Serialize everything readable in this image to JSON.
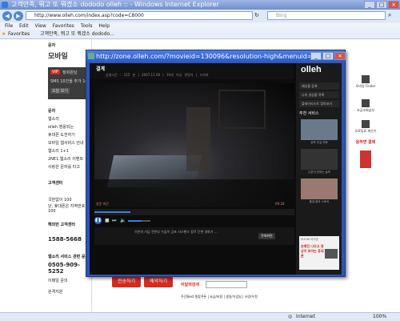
{
  "browser": {
    "title": "고객만족, 뭐고 또 뭐겠소 dododo olleh :: - Windows Internet Explorer",
    "url": "http://www.olleh.com/index.asp?code=C8000",
    "search_placeholder": "Bing",
    "menu": [
      "File",
      "Edit",
      "View",
      "Favorites",
      "Tools",
      "Help"
    ],
    "favorites_label": "Favorites",
    "tab_title": "고객만족, 뭐고 또 뭐겠소 dododo...",
    "status_text": "Internet",
    "zoom": "100%"
  },
  "page": {
    "header_small": "문자",
    "left_title": "모바일",
    "vip_label": "VIP",
    "vip_lines": [
      "정회원님",
      "SMS 10건을 추가 100%",
      "오늘 보기"
    ],
    "left_menu": [
      "문자",
      "웹소리",
      "olleh 영웅되는",
      "휴대폰 도전하기",
      "모바일 웹서비스 안내",
      "웹소리 1+1",
      "2NE1 웹소리 이벤트",
      "사랑은 문자를 타고"
    ],
    "cs_title": "고객센터",
    "cs_phone1": "국번없이 100",
    "cs_line2": "단, 휴대폰은 지역번호 + 100",
    "cs_title2": "해외번 고객센터",
    "cs_phone2": "1588-5668",
    "cs_title3": "웹소리 서비스 관련 문의",
    "cs_phone3": "0505-909-5252",
    "qna_btn": "이메일 문의",
    "chat_btn": "원격지원",
    "order_btn1": "전송하기",
    "order_btn2": "예약하기",
    "bottom_search_label": "이달의검색",
    "bottom_links": "주간Best  종합쿠폰 | 요금/포함 | 생일/기념일 | 사랑/우정",
    "right_bar": [
      "모바일 Finder",
      "요금조회납부",
      "유료동료 계산기"
    ],
    "promo_text": "웅하면 콜레"
  },
  "popup": {
    "url": "http://zone.olleh.com/?movieid=130096&resolution-high&menuid=1...",
    "title": "결계",
    "meta": "상영시간 : 125 분   |   2007.11.08   |   19세 이상 관람가   |   드라마",
    "video_label_left": "갈운 피곤",
    "video_label_right": "09:28",
    "subtitle_info": "이안의 기담 전반부 수없이 공포 서스펜스 장르 단편 영화가 …",
    "fullscreen_label": "전체화면",
    "progress": 0.18,
    "volume": 0.6,
    "logo": "olleh",
    "side_rows": [
      "예상을 등록",
      "나의 영상을 목록",
      "플레이리스트 찾아보기"
    ],
    "side_head": "추천 서비스",
    "thumbs": [
      {
        "cap": "공포 진실 만화",
        "color": "#6a7a8a"
      },
      {
        "cap": "니콘이 전하는 슬릭",
        "color": "#333333"
      },
      {
        "cap": "풍경 음악 스토리",
        "color": "#9a7a70"
      }
    ],
    "ad_top": "SHOW 아이폰",
    "ad_text": "손예진 나오고 영상이 보이는 휴대폰"
  }
}
